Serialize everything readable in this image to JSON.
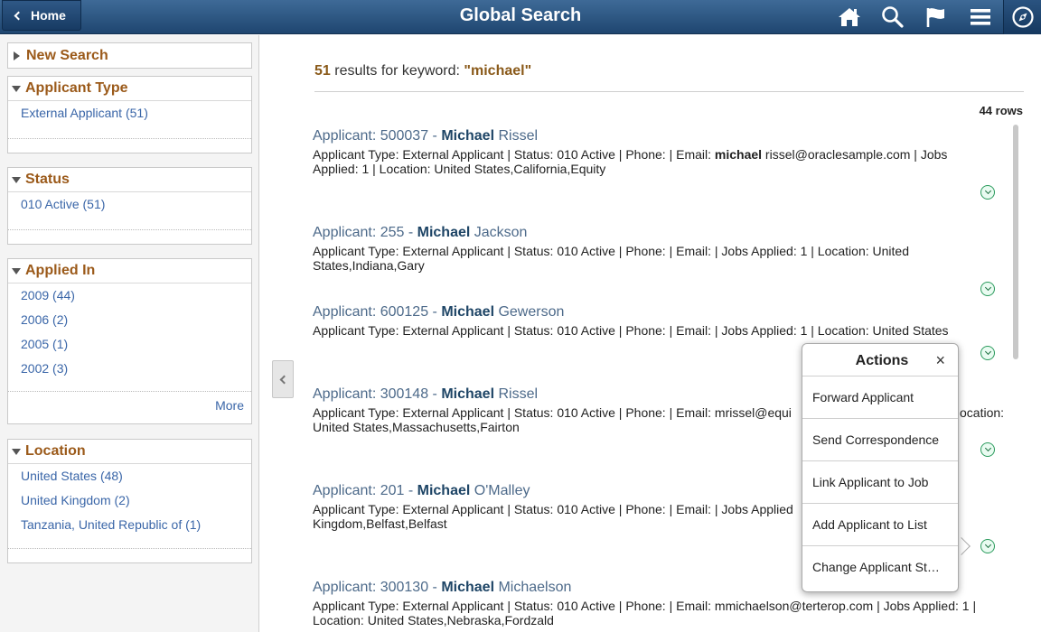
{
  "header": {
    "home_label": "Home",
    "title": "Global Search",
    "icons": [
      "home-icon",
      "search-icon",
      "flag-icon",
      "menu-icon",
      "compass-icon"
    ],
    "bar_color": "#2b5682"
  },
  "facets": {
    "new_search": "New Search",
    "applicant_type": {
      "label": "Applicant Type",
      "items": [
        "External Applicant (51)"
      ]
    },
    "status": {
      "label": "Status",
      "items": [
        "010 Active (51)"
      ]
    },
    "applied_in": {
      "label": "Applied In",
      "items": [
        "2009 (44)",
        "2006 (2)",
        "2005 (1)",
        "2002 (3)"
      ],
      "more": "More"
    },
    "location": {
      "label": "Location",
      "items": [
        "United States (48)",
        "United Kingdom (2)",
        "Tanzania, United Republic of (1)"
      ]
    }
  },
  "summary": {
    "count": "51",
    "text": " results for keyword: ",
    "keyword": "\"michael\"",
    "rows": "44 rows"
  },
  "results": [
    {
      "prefix": "Applicant: 500037 - ",
      "hl": "Michael",
      "rest": " Rissel",
      "desc_a": "Applicant Type: External Applicant | Status: 010 Active | Phone: | Email: ",
      "desc_hl": "michael",
      "desc_b": " rissel@oraclesample.com | Jobs Applied: 1 | Location: United States,California,Equity"
    },
    {
      "prefix": "Applicant: 255 - ",
      "hl": "Michael",
      "rest": " Jackson",
      "desc_a": "Applicant Type: External Applicant | Status: 010 Active | Phone: | Email: | Jobs Applied: 1 | Location: United States,Indiana,Gary",
      "desc_hl": "",
      "desc_b": ""
    },
    {
      "prefix": "Applicant: 600125 - ",
      "hl": "Michael",
      "rest": " Gewerson",
      "desc_a": "Applicant Type: External Applicant | Status: 010 Active | Phone: | Email: | Jobs Applied: 1 | Location: United States",
      "desc_hl": "",
      "desc_b": ""
    },
    {
      "prefix": "Applicant: 300148 - ",
      "hl": "Michael",
      "rest": " Rissel",
      "desc_a": "Applicant Type: External Applicant | Status: 010 Active | Phone: | Email: mrissel@equi",
      "desc_hl": "",
      "desc_b": ""
    },
    {
      "prefix": "Applicant: 201 - ",
      "hl": "Michael",
      "rest": " O'Malley",
      "desc_a": "Applicant Type: External Applicant | Status: 010 Active | Phone: | Email: | Jobs Applied",
      "desc_hl": "",
      "desc_b": ""
    },
    {
      "prefix": "Applicant: 300130 - ",
      "hl": "Michael",
      "rest": " Michaelson",
      "desc_a": "Applicant Type: External Applicant | Status: 010 Active | Phone: | Email: mmichaelson@terterop.com | Jobs Applied: 1 | Location: United States,Nebraska,Fordzald",
      "desc_hl": "",
      "desc_b": ""
    }
  ],
  "result_fragments": {
    "r4_tail_a": "ocation:",
    "r4_tail_b": "United States,Massachusetts,Fairton",
    "r5_tail_b": "Kingdom,Belfast,Belfast"
  },
  "actions_popup": {
    "title": "Actions",
    "close": "×",
    "items": [
      "Forward Applicant",
      "Send Correspondence",
      "Link Applicant to Job",
      "Add Applicant to List",
      "Change Applicant St…"
    ]
  }
}
